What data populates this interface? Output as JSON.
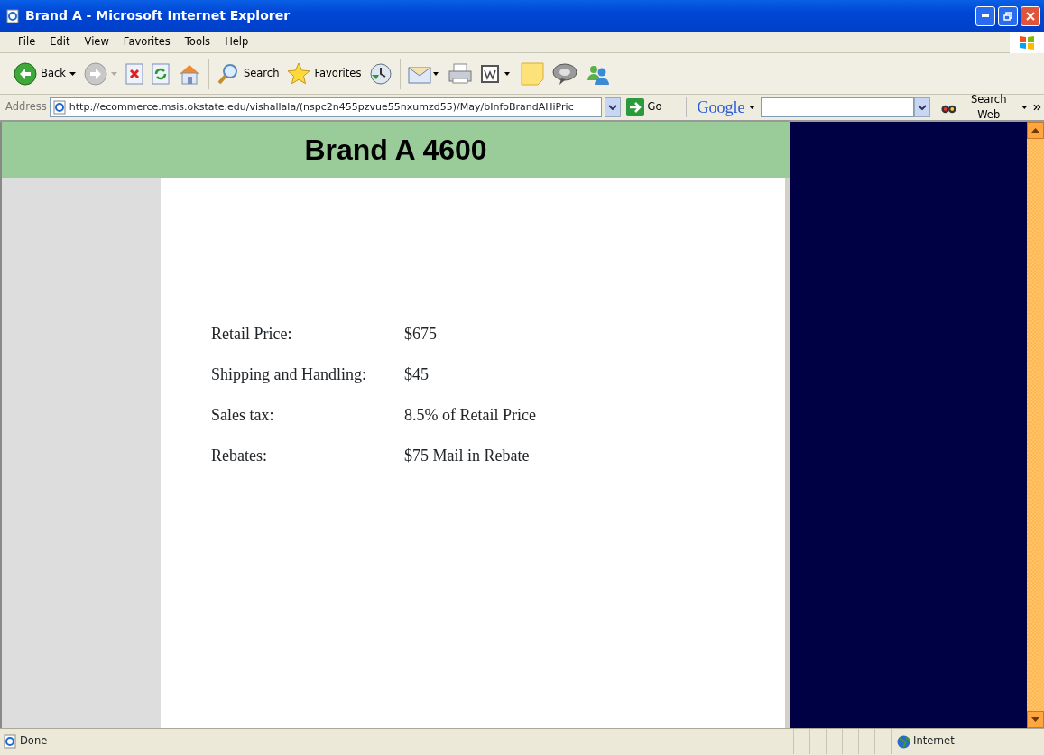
{
  "window": {
    "title": "Brand A - Microsoft Internet Explorer"
  },
  "menu": [
    "File",
    "Edit",
    "View",
    "Favorites",
    "Tools",
    "Help"
  ],
  "toolbar": [
    {
      "kind": "back",
      "label": "Back"
    },
    {
      "kind": "forward"
    },
    {
      "kind": "stop"
    },
    {
      "kind": "refresh"
    },
    {
      "kind": "home"
    },
    {
      "kind": "search",
      "label": "Search"
    },
    {
      "kind": "favorites",
      "label": "Favorites"
    },
    {
      "kind": "history"
    },
    {
      "kind": "mail"
    },
    {
      "kind": "print"
    },
    {
      "kind": "edit"
    },
    {
      "kind": "note"
    },
    {
      "kind": "discuss"
    },
    {
      "kind": "messenger"
    }
  ],
  "address": {
    "label": "Address",
    "url": "http://ecommerce.msis.okstate.edu/vishallala/(nspc2n455pzvue55nxumzd55)/May/bInfoBrandAHiPric",
    "go": "Go"
  },
  "google": {
    "logo": "Google",
    "search_web": "Search Web"
  },
  "page": {
    "heading": "Brand A 4600",
    "rows": [
      {
        "label": "Retail Price:",
        "value": "$675"
      },
      {
        "label": "Shipping and Handling:",
        "value": "$45"
      },
      {
        "label": "Sales tax:",
        "value": "8.5% of Retail Price"
      },
      {
        "label": "Rebates:",
        "value": "$75 Mail in Rebate"
      }
    ]
  },
  "status_bar": {
    "text": "Done",
    "zone": "Internet"
  }
}
